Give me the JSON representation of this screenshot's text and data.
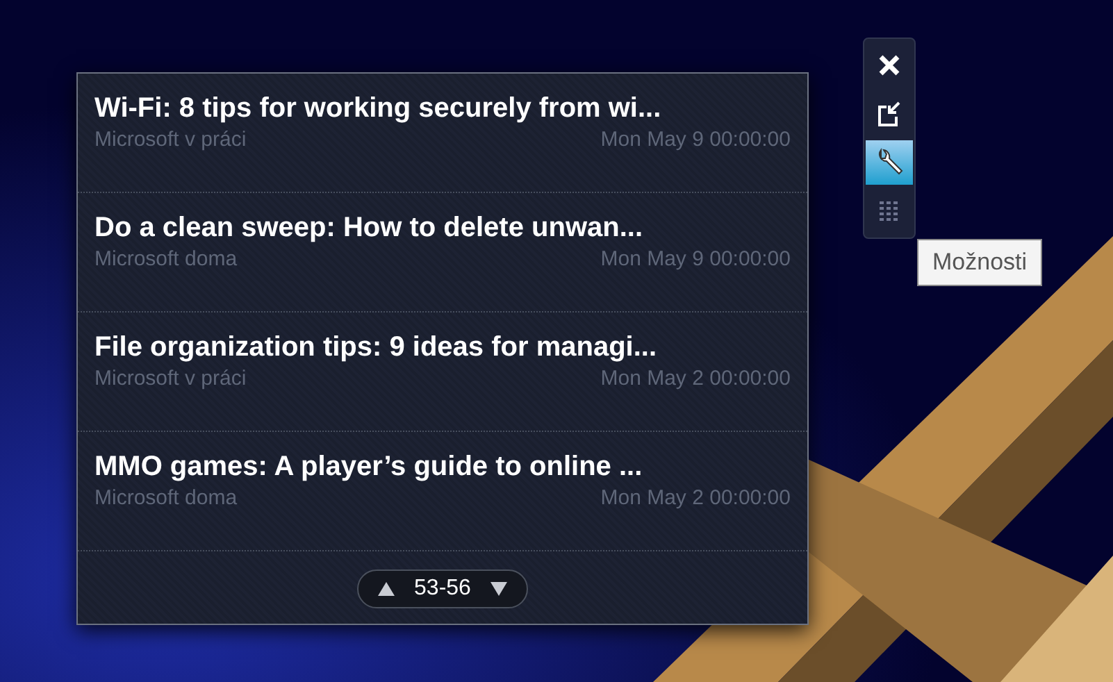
{
  "gadget": {
    "items": [
      {
        "title": "Wi-Fi: 8 tips for working securely from wi...",
        "source": "Microsoft v práci",
        "date": "Mon May 9 00:00:00"
      },
      {
        "title": "Do a clean sweep: How to delete unwan...",
        "source": "Microsoft doma",
        "date": "Mon May 9 00:00:00"
      },
      {
        "title": "File organization tips: 9 ideas for managi...",
        "source": "Microsoft v práci",
        "date": "Mon May 2 00:00:00"
      },
      {
        "title": "MMO games: A player’s guide to online ...",
        "source": "Microsoft doma",
        "date": "Mon May 2 00:00:00"
      }
    ],
    "pager": {
      "range": "53-56"
    }
  },
  "toolbar": {
    "buttons": [
      {
        "kind": "close",
        "selected": false
      },
      {
        "kind": "resize",
        "selected": false
      },
      {
        "kind": "options",
        "selected": true
      },
      {
        "kind": "drag",
        "selected": false
      }
    ]
  },
  "tooltip": {
    "text": "Možnosti"
  }
}
